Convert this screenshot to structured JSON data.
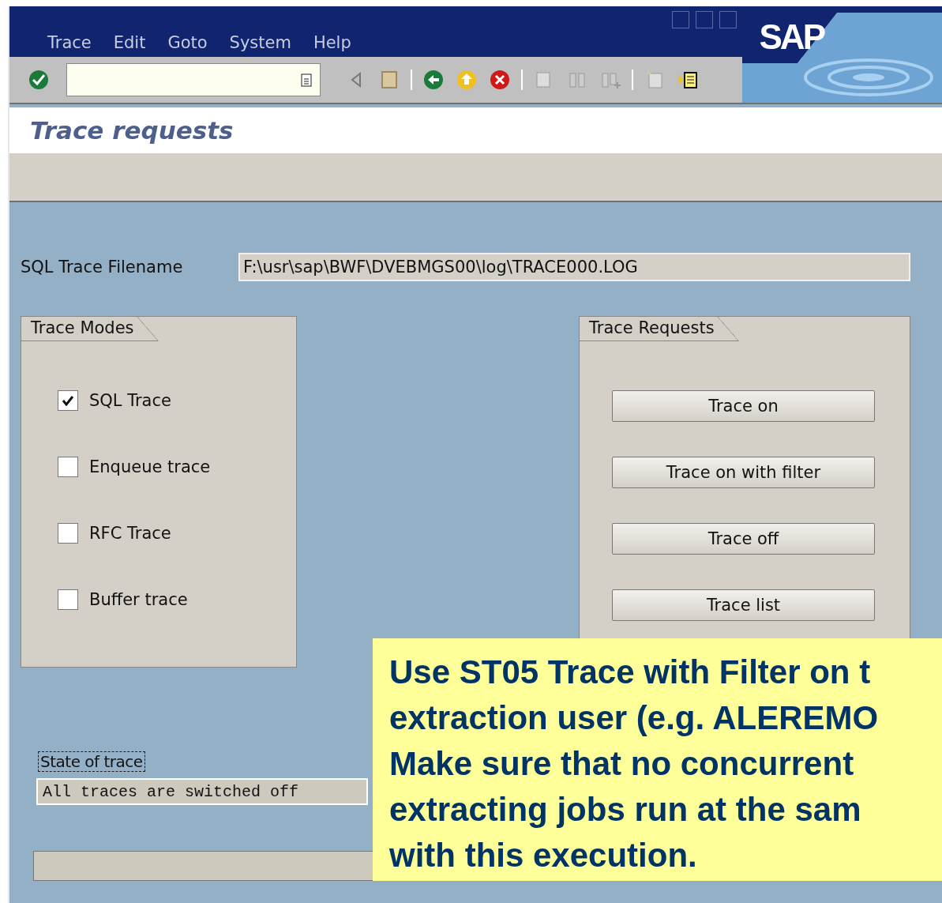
{
  "menu": [
    {
      "label": "Trace"
    },
    {
      "label": "Edit"
    },
    {
      "label": "Goto"
    },
    {
      "label": "System"
    },
    {
      "label": "Help"
    }
  ],
  "logo": "SAP",
  "screen_title": "Trace requests",
  "sql_trace_filename": {
    "label": "SQL Trace Filename",
    "value": "F:\\usr\\sap\\BWF\\DVEBMGS00\\log\\TRACE000.LOG"
  },
  "trace_modes": {
    "title": "Trace Modes",
    "options": [
      {
        "label": "SQL Trace",
        "checked": true
      },
      {
        "label": "Enqueue trace",
        "checked": false
      },
      {
        "label": "RFC Trace",
        "checked": false
      },
      {
        "label": "Buffer trace",
        "checked": false
      }
    ]
  },
  "trace_requests": {
    "title": "Trace Requests",
    "buttons": [
      "Trace on",
      "Trace on with filter",
      "Trace off",
      "Trace list"
    ]
  },
  "state_of_trace": {
    "label": "State of trace",
    "value": "All traces are switched off"
  },
  "callout": {
    "lines": [
      "Use ST05 Trace with Filter on t",
      "extraction user (e.g. ALEREMO",
      "Make sure that no concurrent",
      "extracting jobs run at the sam",
      "with this execution."
    ]
  }
}
